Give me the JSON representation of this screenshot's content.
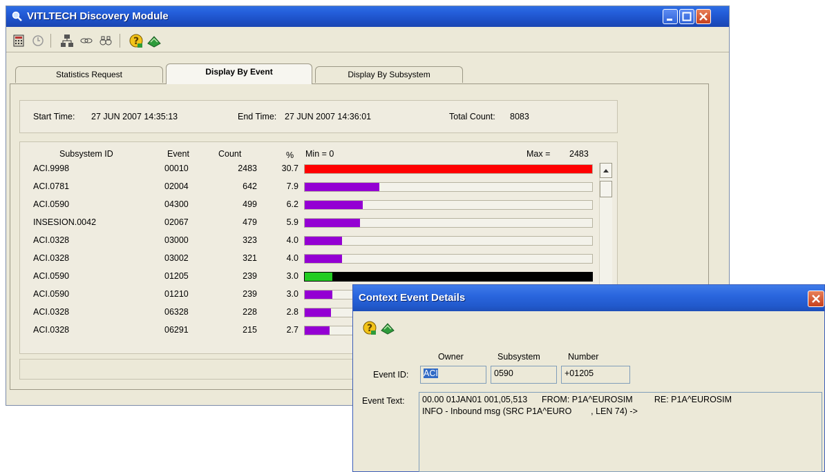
{
  "window": {
    "title": "VITLTECH Discovery Module"
  },
  "toolbar": {
    "icons": [
      "calculator-icon",
      "clock-icon",
      "network-icon",
      "connect-icon",
      "binoculars-icon",
      "help-icon",
      "exit-icon"
    ]
  },
  "tabs": [
    {
      "label": "Statistics Request",
      "active": false
    },
    {
      "label": "Display By Event",
      "active": true
    },
    {
      "label": "Display By Subsystem",
      "active": false
    }
  ],
  "summary": {
    "start_label": "Start Time:",
    "start_value": "27 JUN 2007  14:35:13",
    "end_label": "End Time:",
    "end_value": "27 JUN 2007  14:36:01",
    "total_label": "Total Count:",
    "total_value": "8083"
  },
  "table": {
    "headers": {
      "subsystem": "Subsystem ID",
      "event": "Event",
      "count": "Count",
      "pct": "%",
      "min": "Min = 0",
      "max_label": "Max =",
      "max_value": "2483"
    },
    "rows": [
      {
        "subsystem": "ACI.9998",
        "event": "00010",
        "count": "2483",
        "pct": "30.7",
        "fraction": 1.0,
        "color": "#ff0000"
      },
      {
        "subsystem": "ACI.0781",
        "event": "02004",
        "count": "642",
        "pct": "7.9",
        "fraction": 0.2586,
        "color": "#9400d3"
      },
      {
        "subsystem": "ACI.0590",
        "event": "04300",
        "count": "499",
        "pct": "6.2",
        "fraction": 0.201,
        "color": "#9400d3"
      },
      {
        "subsystem": "INSESION.0042",
        "event": "02067",
        "count": "479",
        "pct": "5.9",
        "fraction": 0.1929,
        "color": "#9400d3"
      },
      {
        "subsystem": "ACI.0328",
        "event": "03000",
        "count": "323",
        "pct": "4.0",
        "fraction": 0.1301,
        "color": "#9400d3"
      },
      {
        "subsystem": "ACI.0328",
        "event": "03002",
        "count": "321",
        "pct": "4.0",
        "fraction": 0.1293,
        "color": "#9400d3"
      },
      {
        "subsystem": "ACI.0590",
        "event": "01205",
        "count": "239",
        "pct": "3.0",
        "fraction": 0.0963,
        "color": "#22cc22",
        "selected": true
      },
      {
        "subsystem": "ACI.0590",
        "event": "01210",
        "count": "239",
        "pct": "3.0",
        "fraction": 0.0963,
        "color": "#9400d3"
      },
      {
        "subsystem": "ACI.0328",
        "event": "06328",
        "count": "228",
        "pct": "2.8",
        "fraction": 0.0918,
        "color": "#9400d3"
      },
      {
        "subsystem": "ACI.0328",
        "event": "06291",
        "count": "215",
        "pct": "2.7",
        "fraction": 0.0866,
        "color": "#9400d3"
      }
    ]
  },
  "dialog": {
    "title": "Context Event Details",
    "owner_label": "Owner",
    "subsystem_label": "Subsystem",
    "number_label": "Number",
    "event_id_label": "Event ID:",
    "owner_value": "ACI",
    "subsystem_value": "0590",
    "number_value": "+01205",
    "event_text_label": "Event Text:",
    "event_text_line1": "00.00 01JAN01 001,05,513      FROM: P1A^EUROSIM         RE: P1A^EUROSIM",
    "event_text_line2": "INFO - Inbound msg (SRC P1A^EURO        , LEN 74) ->"
  }
}
